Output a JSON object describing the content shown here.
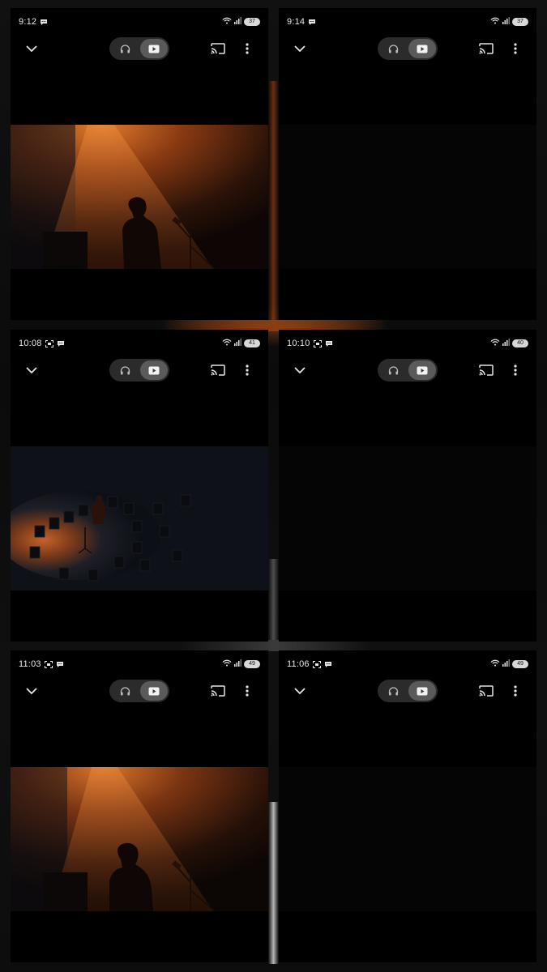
{
  "panels": [
    {
      "status": {
        "time": "9:12",
        "battery": "37",
        "left_icons": [
          "chat-bubble-icon"
        ]
      },
      "scene": "spotlight-performer"
    },
    {
      "status": {
        "time": "9:14",
        "battery": "37",
        "left_icons": [
          "chat-bubble-icon"
        ]
      },
      "scene": "dark"
    },
    {
      "status": {
        "time": "10:08",
        "battery": "41",
        "left_icons": [
          "screenshot-icon",
          "chat-bubble-icon"
        ]
      },
      "scene": "overhead-stage-chairs"
    },
    {
      "status": {
        "time": "10:10",
        "battery": "40",
        "left_icons": [
          "screenshot-icon",
          "chat-bubble-icon"
        ]
      },
      "scene": "dark"
    },
    {
      "status": {
        "time": "11:03",
        "battery": "49",
        "left_icons": [
          "screenshot-icon",
          "chat-bubble-icon"
        ]
      },
      "scene": "spotlight-performer-closeup"
    },
    {
      "status": {
        "time": "11:06",
        "battery": "49",
        "left_icons": [
          "screenshot-icon",
          "chat-bubble-icon"
        ]
      },
      "scene": "dark"
    }
  ],
  "toolbar": {
    "icons": [
      "chevron-down-icon",
      "headphones-icon",
      "video-play-icon",
      "cast-icon",
      "more-vert-icon"
    ],
    "selected_mode": "video"
  },
  "colors": {
    "background": "#000000",
    "toggle_track": "#2b2b2b",
    "toggle_selected": "#5a5a5a",
    "icon": "#e6e6e6",
    "spotlight": "#c0601f"
  }
}
